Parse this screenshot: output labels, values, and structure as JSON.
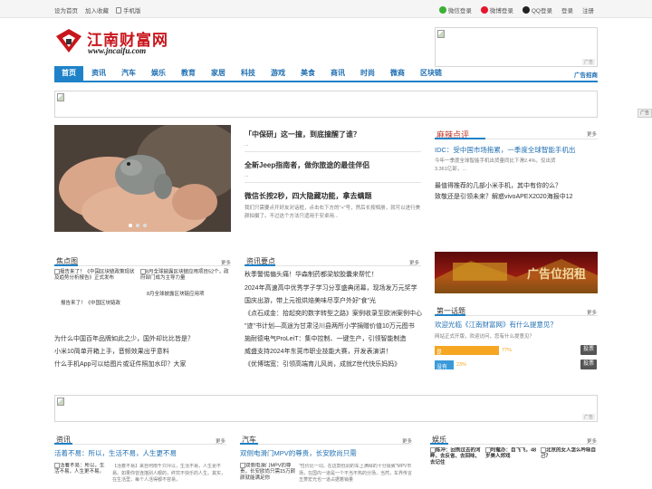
{
  "topbar": {
    "left": [
      "设为首页",
      "加入收藏",
      "手机版"
    ],
    "right": [
      {
        "label": "微信登录",
        "icon": "wechat-icon",
        "color": "#3cb034"
      },
      {
        "label": "微博登录",
        "icon": "weibo-icon",
        "color": "#e6162d"
      },
      {
        "label": "QQ登录",
        "icon": "qq-icon",
        "color": "#222222"
      },
      {
        "label": "登录"
      },
      {
        "label": "注册"
      }
    ]
  },
  "logo": {
    "name": "江南财富网",
    "url": "www.jncaifu.com"
  },
  "ad_label": "广告",
  "nav": {
    "items": [
      "首页",
      "资讯",
      "汽车",
      "娱乐",
      "教育",
      "家居",
      "科技",
      "游戏",
      "美食",
      "商讯",
      "时尚",
      "微商",
      "区块链"
    ],
    "active_index": 0,
    "ad_guide": "广告招商",
    "accent": "#1f82c8"
  },
  "side_ad_label": "广告",
  "slide": {
    "dots": 3,
    "active": 0
  },
  "headlines": [
    {
      "title": "「中保研」这一撞，到底撞醒了谁？",
      "summary": "..."
    },
    {
      "title": "全新Jeep指南者，做你旅途的最佳伴侣",
      "summary": "..."
    },
    {
      "title": "微信长按2秒，四大隐藏功能，拿去螨题",
      "summary": "我们只需要点开好友对话框，点击右下方的\"+\"号，然后长按相册，就可以进行美颜拍摄了。不过这个方法只适用于安卓用..."
    }
  ],
  "spicy": {
    "title": "麻辣点评",
    "more": "更多",
    "lead": "IDC：受中国市场拖累，一季度全球智能手机出",
    "lead_summary": "今年一季度全球智能手机出货量同比下滑2.4%，仅出货3.361亿部，...",
    "items": [
      "最值得推荐的几部小米手机，其中有你的么？",
      "致敬还是引领未来？解惑vivoAPEX2020海报中12"
    ]
  },
  "focus": {
    "title": "焦点图",
    "more": "更多",
    "img1_alt": "报告来了！《中国区块链政策现状及趋势分析报告》正式发布",
    "img2_alt": "8月全球披露区块链应用项目52个，政府部门成为主导力量",
    "cap1": "报告来了！《中国区块链政",
    "cap2": "8月全球披露区块链应用项",
    "links": [
      "为什么中国百年品牌如此之少，国外却比比皆是？",
      "小米10简单开箱上手，音频效果出乎意料",
      "什么手机App可以给图片或证件照加水印？大家"
    ]
  },
  "news": {
    "title": "资讯要点",
    "more": "更多",
    "items": [
      "秋季警惕偏头痛！华森制药都梁软胶囊来帮忙！",
      "2024年高速高中优秀学子学习分享盛典闭幕，现场发万元奖学",
      "国庆出游，带上元祖烘焙美味尽享户外好\"食\"光",
      "《点石成金：拾起奕的数字转型之路》案例收录至欧洲案例中心",
      "\"迹\"书计划—高途为甘肃泾川县两所小学捐赠价值10万元图书",
      "施耐德电气ProLeiT：集中控制、一键生产，引领智能制造",
      "威盛支持2024年东莞市职业技能大赛，开发表演讲！",
      "《优博瑞宽：引领高端育儿风尚，成就Z世代快乐妈妈》"
    ]
  },
  "side_ad2_text": "广告位招租",
  "first_topic": {
    "title": "第一话题",
    "more": "更多",
    "question": "欢迎光临《江南财富网》有什么提意见？",
    "summary": "网站正式开版，欢迎访问，您有什么提意见？",
    "options": [
      {
        "label": "是",
        "percent": 77,
        "color": "#f5a623",
        "vote": "投票"
      },
      {
        "label": "没有",
        "percent": 23,
        "color": "#3a9ad9",
        "vote": "投票"
      }
    ]
  },
  "bottom_ad_label": "广告",
  "col_news": {
    "title": "资讯",
    "more": "更多",
    "headline": "活着不易：所以，生活不易，人生更不易",
    "img_alt": "活着不易：所以，生活不易，人生更不易。",
    "summary": "【活着不易】来自何南千只坪以，生活不易，人生更不易。如果你曾连描别人眼的，终究不快乐的人生。其实，在生活里，每个人活得都不容易，"
  },
  "col_auto": {
    "title": "汽车",
    "more": "更多",
    "headline": "双侧电滑门MPV的尊贵，长安欧尚只需",
    "img_alt": "双侧电滑门MPV的尊贵，长安欧尚只需15万颜颜就能满足你",
    "summary": "\"性价比一词，在这款低调的车上满绎的十分极致\"MPV市场，在国内一道是一个不当不热的分场，当然，车界传言五菱宏光也一道占据着销量"
  },
  "col_ent": {
    "title": "娱乐",
    "more": "更多",
    "items": [
      "陈冲：回到过去的河畔，去反省、去回味、去记住",
      "时髦办：自飞飞，48岁美人郊戏",
      "北京的女人怎么吟咏自己？"
    ]
  },
  "side_tab": "广告"
}
